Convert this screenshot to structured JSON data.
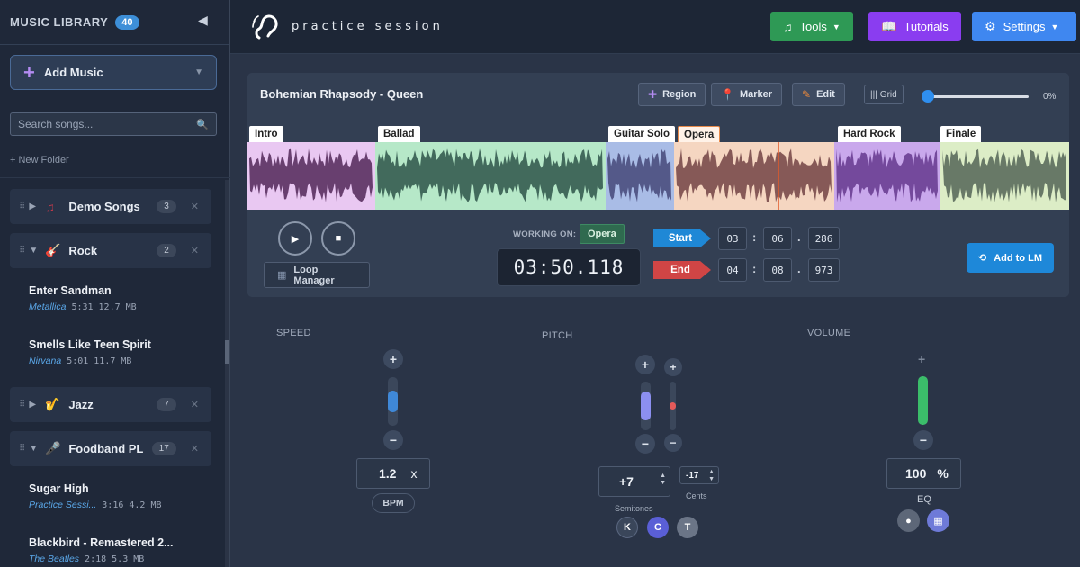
{
  "sidebar": {
    "title": "MUSIC LIBRARY",
    "count": "40",
    "collapse_icon": "◀",
    "add_music": "Add Music",
    "search_placeholder": "Search songs...",
    "new_folder": "+ New Folder",
    "folders": [
      {
        "name": "Demo Songs",
        "count": "3",
        "icon": "♫",
        "color": "#c0394b",
        "expanded": false
      },
      {
        "name": "Rock",
        "count": "2",
        "icon": "🎸",
        "color": "#e0524a",
        "expanded": true
      },
      {
        "name": "Jazz",
        "count": "7",
        "icon": "🎷",
        "color": "#e3a93a",
        "expanded": false
      },
      {
        "name": "Foodband PL",
        "count": "17",
        "icon": "🎤",
        "color": "#c77dd1",
        "expanded": true
      }
    ],
    "songs": [
      {
        "title": "Enter Sandman",
        "artist": "Metallica",
        "info": "5:31  12.7 MB"
      },
      {
        "title": "Smells Like Teen Spirit",
        "artist": "Nirvana",
        "info": "5:01  11.7 MB"
      },
      {
        "title": "Sugar High",
        "artist": "Practice Sessi...",
        "info": "3:16  4.2 MB"
      },
      {
        "title": "Blackbird - Remastered 2...",
        "artist": "The Beatles",
        "info": "2:18  5.3 MB"
      }
    ]
  },
  "topbar": {
    "logo": "practice session",
    "tools": "Tools",
    "tutorials": "Tutorials",
    "settings": "Settings",
    "colors": {
      "tools": "#2e9955",
      "tutorials": "#8a3df0",
      "settings": "#3f87f0"
    }
  },
  "panel": {
    "song_title": "Bohemian Rhapsody - Queen",
    "region": "Region",
    "marker": "Marker",
    "edit": "Edit",
    "grid": "Grid",
    "zoom": "0%",
    "zoom_level": 0,
    "segments": [
      {
        "label": "Intro",
        "color": "#e9c8f2",
        "wave": "#5a3060"
      },
      {
        "label": "Ballad",
        "color": "#b6e8c8",
        "wave": "#355c50"
      },
      {
        "label": "Guitar Solo",
        "color": "#a9bce6",
        "wave": "#4a4e7e"
      },
      {
        "label": "Opera",
        "color": "#f5d6c1",
        "wave": "#7a4b4b"
      },
      {
        "label": "Hard Rock",
        "color": "#c9a8ec",
        "wave": "#6a3e94"
      },
      {
        "label": "Finale",
        "color": "#dcedc6",
        "wave": "#5b6b5c"
      }
    ],
    "loop_manager": "Loop Manager",
    "working_on_label": "WORKING ON:",
    "working_on": "Opera",
    "timer": "03:50.118",
    "start_label": "Start",
    "end_label": "End",
    "start": [
      "03",
      "06",
      "286"
    ],
    "end": [
      "04",
      "08",
      "973"
    ],
    "add_lm": "Add to LM"
  },
  "controls": {
    "speed_label": "SPEED",
    "pitch_label": "PITCH",
    "volume_label": "VOLUME",
    "speed_value": "1.2",
    "speed_unit": "x",
    "bpm": "BPM",
    "semitones_value": "+7",
    "cents_value": "-17",
    "semitones_label": "Semitones",
    "cents_label": "Cents",
    "kct": [
      "K",
      "C",
      "T"
    ],
    "volume_value": "100",
    "volume_unit": "%",
    "eq": "EQ",
    "speed_level": 0.45,
    "semitones_level": 0.6,
    "cents_level": 0.15,
    "volume_level": 1.0
  }
}
